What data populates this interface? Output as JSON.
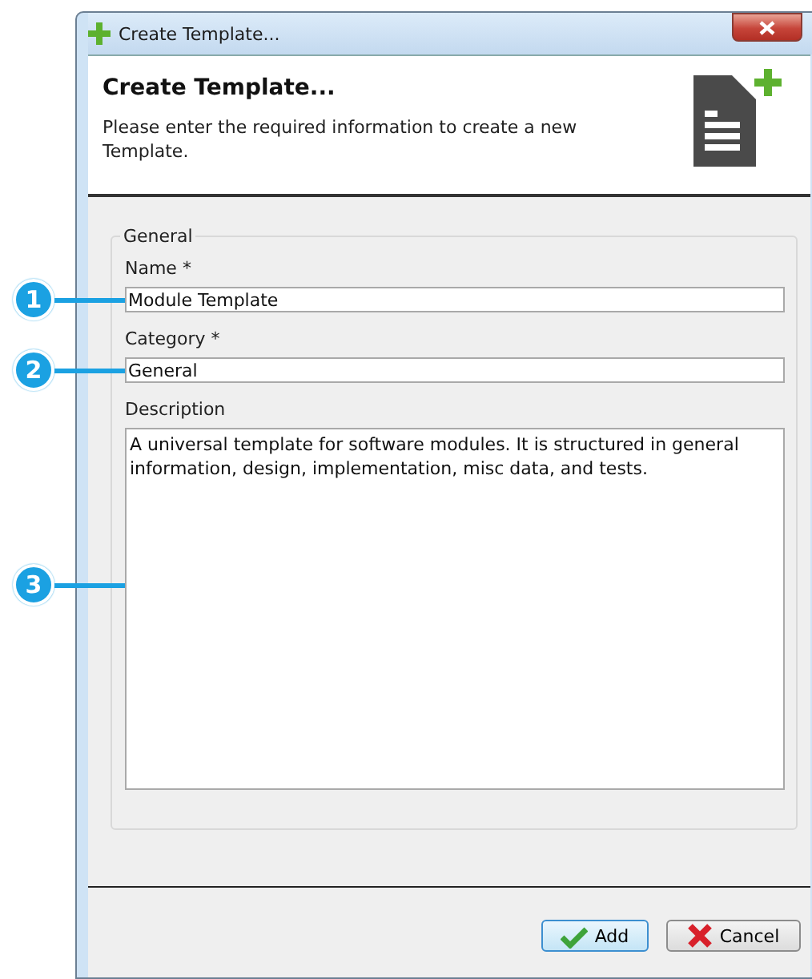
{
  "window": {
    "title": "Create Template..."
  },
  "header": {
    "title": "Create Template...",
    "description": "Please enter the required information to create a new Template."
  },
  "group": {
    "title": "General",
    "fields": [
      {
        "label": "Name *",
        "value": "Module Template",
        "kind": "line"
      },
      {
        "label": "Category *",
        "value": "General",
        "kind": "line"
      },
      {
        "label": "Description",
        "value": "A universal template for software modules. It is structured in general information, design, implementation, misc data, and tests.",
        "kind": "area"
      }
    ]
  },
  "buttons": [
    {
      "label": "Add",
      "kind": "ok"
    },
    {
      "label": "Cancel",
      "kind": "cancel"
    }
  ],
  "callouts": [
    {
      "number": "1"
    },
    {
      "number": "2"
    },
    {
      "number": "3"
    }
  ]
}
